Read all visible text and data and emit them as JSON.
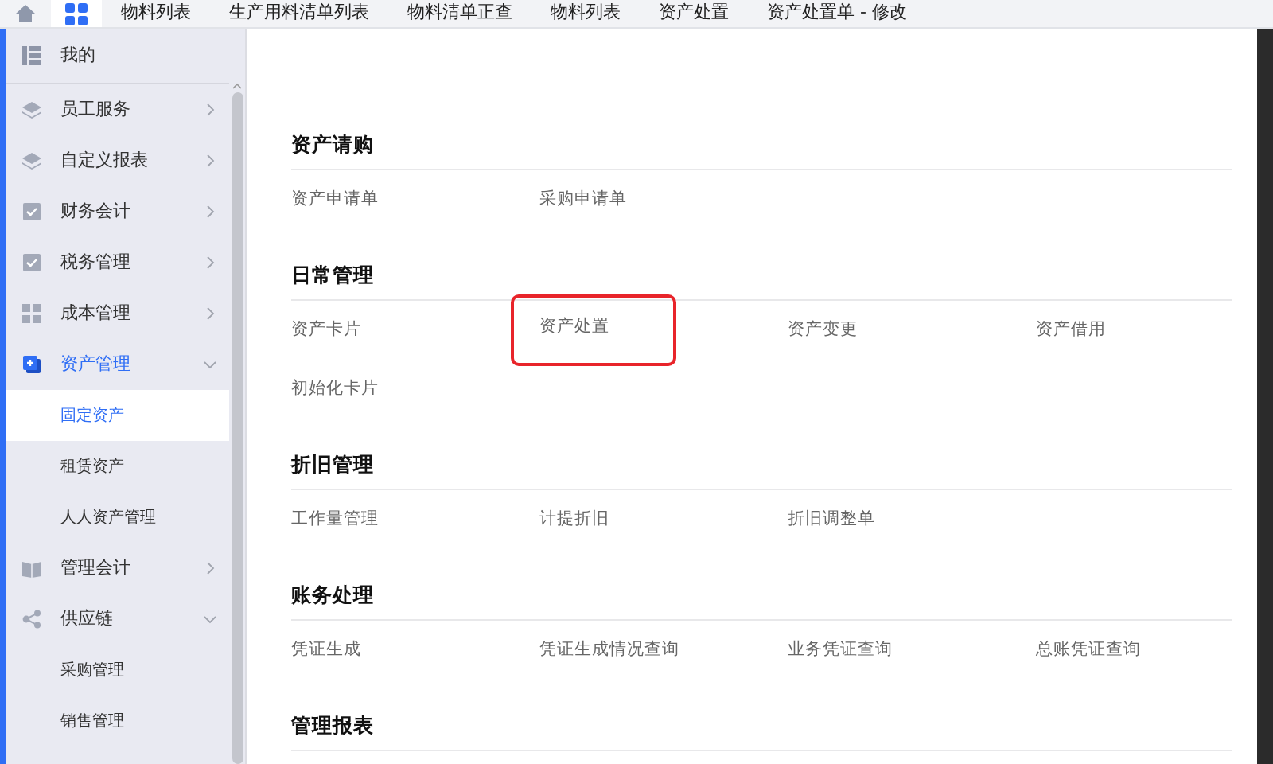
{
  "tabs": [
    {
      "kind": "home",
      "selected": false
    },
    {
      "kind": "apps",
      "selected": true
    },
    {
      "kind": "text",
      "label": "物料列表",
      "selected": false
    },
    {
      "kind": "text",
      "label": "生产用料清单列表",
      "selected": false
    },
    {
      "kind": "text",
      "label": "物料清单正查",
      "selected": false
    },
    {
      "kind": "text",
      "label": "物料列表",
      "selected": false
    },
    {
      "kind": "text",
      "label": "资产处置",
      "selected": false
    },
    {
      "kind": "text",
      "label": "资产处置单 - 修改",
      "selected": false
    }
  ],
  "sidebar": {
    "items": [
      {
        "kind": "header",
        "label": "我的"
      },
      {
        "kind": "menu",
        "label": "员工服务",
        "expanded": false,
        "selected": false
      },
      {
        "kind": "menu",
        "label": "自定义报表",
        "expanded": false,
        "selected": false
      },
      {
        "kind": "menu",
        "label": "财务会计",
        "expanded": false,
        "selected": false
      },
      {
        "kind": "menu",
        "label": "税务管理",
        "expanded": false,
        "selected": false
      },
      {
        "kind": "menu",
        "label": "成本管理",
        "expanded": false,
        "selected": false
      },
      {
        "kind": "menu",
        "label": "资产管理",
        "expanded": true,
        "selected": true
      },
      {
        "kind": "sub",
        "label": "固定资产",
        "selected": true
      },
      {
        "kind": "sub",
        "label": "租赁资产",
        "selected": false
      },
      {
        "kind": "sub",
        "label": "人人资产管理",
        "selected": false
      },
      {
        "kind": "menu",
        "label": "管理会计",
        "expanded": false,
        "selected": false
      },
      {
        "kind": "menu",
        "label": "供应链",
        "expanded": true,
        "selected": false
      },
      {
        "kind": "sub",
        "label": "采购管理",
        "selected": false
      },
      {
        "kind": "sub",
        "label": "销售管理",
        "selected": false
      }
    ]
  },
  "sections": [
    {
      "title": "资产请购",
      "links": [
        {
          "label": "资产申请单",
          "highlighted": false
        },
        {
          "label": "采购申请单",
          "highlighted": false
        }
      ]
    },
    {
      "title": "日常管理",
      "links": [
        {
          "label": "资产卡片",
          "highlighted": false
        },
        {
          "label": "资产处置",
          "highlighted": true
        },
        {
          "label": "资产变更",
          "highlighted": false
        },
        {
          "label": "资产借用",
          "highlighted": false
        },
        {
          "label": "初始化卡片",
          "highlighted": false
        }
      ]
    },
    {
      "title": "折旧管理",
      "links": [
        {
          "label": "工作量管理",
          "highlighted": false
        },
        {
          "label": "计提折旧",
          "highlighted": false
        },
        {
          "label": "折旧调整单",
          "highlighted": false
        }
      ]
    },
    {
      "title": "账务处理",
      "links": [
        {
          "label": "凭证生成",
          "highlighted": false
        },
        {
          "label": "凭证生成情况查询",
          "highlighted": false
        },
        {
          "label": "业务凭证查询",
          "highlighted": false
        },
        {
          "label": "总账凭证查询",
          "highlighted": false
        }
      ]
    },
    {
      "title": "管理报表"
    }
  ]
}
